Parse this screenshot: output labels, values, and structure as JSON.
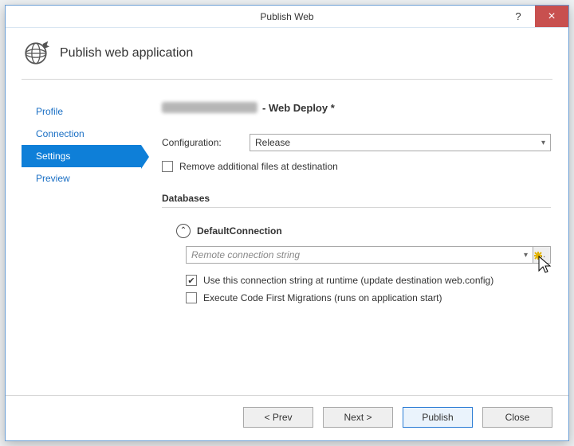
{
  "window": {
    "title": "Publish Web",
    "heading": "Publish web application",
    "help_tooltip": "?",
    "close_label": "×"
  },
  "sidebar": {
    "items": [
      {
        "label": "Profile",
        "active": false
      },
      {
        "label": "Connection",
        "active": false
      },
      {
        "label": "Settings",
        "active": true
      },
      {
        "label": "Preview",
        "active": false
      }
    ]
  },
  "main": {
    "site_suffix": " - Web Deploy *",
    "configuration_label": "Configuration:",
    "configuration_value": "Release",
    "remove_files_label": "Remove additional files at destination",
    "databases_heading": "Databases",
    "db": {
      "name": "DefaultConnection",
      "conn_placeholder": "Remote connection string",
      "use_conn_label": "Use this connection string at runtime (update destination web.config)",
      "migrations_label": "Execute Code First Migrations (runs on application start)",
      "use_conn_checked": true,
      "migrations_checked": false
    }
  },
  "footer": {
    "prev": "< Prev",
    "next": "Next >",
    "publish": "Publish",
    "close": "Close"
  }
}
